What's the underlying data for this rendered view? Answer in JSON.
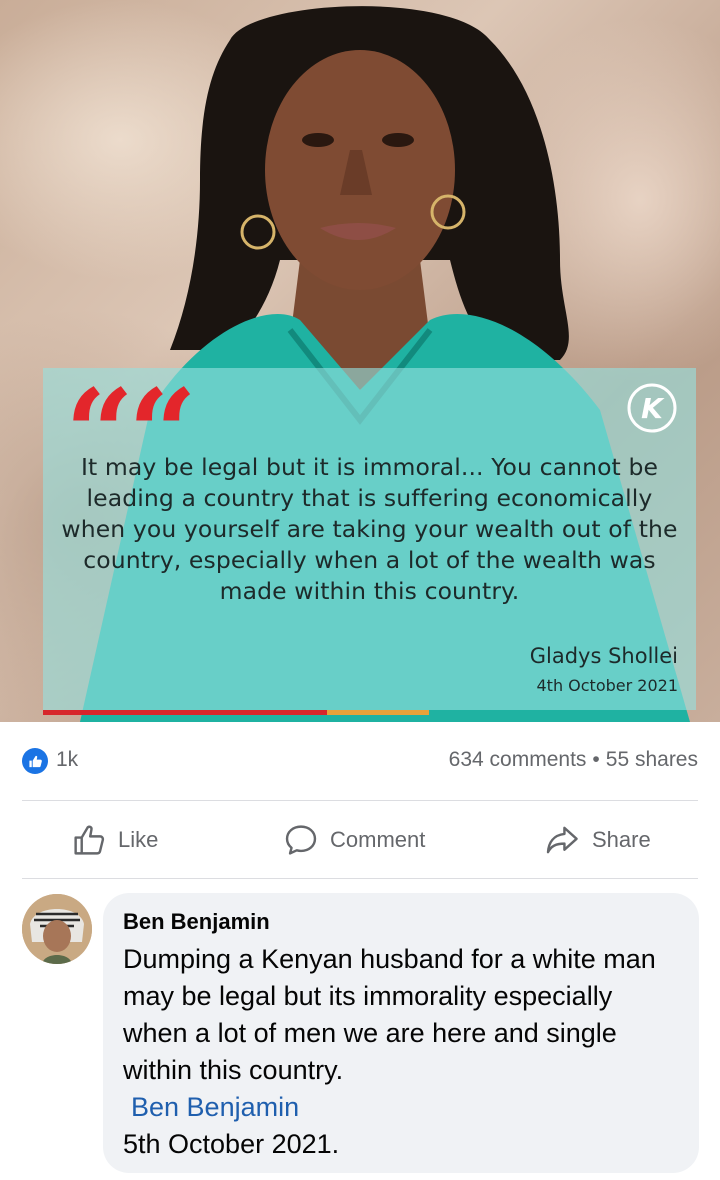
{
  "post": {
    "quote": {
      "text": "It may be legal but it is immoral... You cannot be leading a country that is suffering economically when you yourself are taking your wealth out of the country, especially when a lot of the wealth was made within this country.",
      "author": "Gladys Shollei",
      "date": "4th October 2021",
      "quote_mark": "““",
      "logo_letter": "K",
      "colors": {
        "quote_mark": "#e3262b",
        "card": "#96e1de",
        "bar_red": "#d7262b",
        "bar_yellow": "#e8a23a"
      }
    },
    "stats": {
      "like_count": "1k",
      "comments": "634 comments",
      "separator": "•",
      "shares": "55 shares"
    },
    "actions": {
      "like": "Like",
      "comment": "Comment",
      "share": "Share"
    }
  },
  "comment": {
    "author": "Ben Benjamin",
    "text": "Dumping a Kenyan husband for a white man may be legal but its immorality especially when a lot of men we are here and single within this country.",
    "signature": "Ben Benjamin",
    "date": "5th October 2021."
  },
  "icons": {
    "like_badge": "thumbs-up-icon",
    "like": "thumbs-up-outline-icon",
    "comment": "speech-bubble-icon",
    "share": "share-arrow-icon"
  },
  "accent_color": "#1b74e4"
}
